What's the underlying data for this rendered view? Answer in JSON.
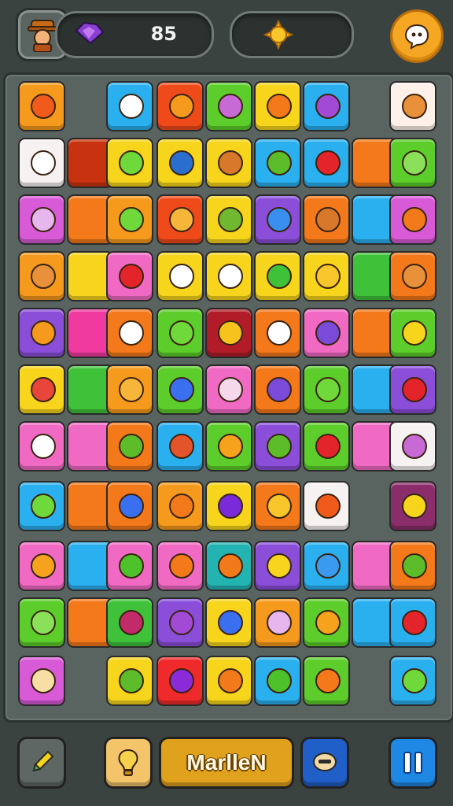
{
  "hud": {
    "score": "85",
    "accent_color": "#f5a623"
  },
  "bottom_bar": {
    "main_button_label": "MarlleN"
  },
  "board": {
    "tiles": [
      {
        "row": 0,
        "col": 0,
        "color": "#f59a1c",
        "icon": "flame-icon"
      },
      {
        "row": 0,
        "col": 2,
        "color": "#2ab0ef",
        "icon": "speech-bubble-icon"
      },
      {
        "row": 0,
        "col": 3,
        "color": "#ef4a1a",
        "icon": "pumpkin-icon"
      },
      {
        "row": 0,
        "col": 4,
        "color": "#5ccd2a",
        "icon": "gear-flower-icon"
      },
      {
        "row": 0,
        "col": 5,
        "color": "#f6d51c",
        "icon": "orange-fruit-icon"
      },
      {
        "row": 0,
        "col": 6,
        "color": "#2ab0ef",
        "icon": "gear-icon"
      },
      {
        "row": 0,
        "col": 8,
        "color": "#fff1ea",
        "icon": "bread-icon"
      },
      {
        "row": 1,
        "col": 0,
        "color": "#f7f2f2",
        "icon": "cream-icon"
      },
      {
        "row": 1,
        "col": 1,
        "color": "#c8320e",
        "icon": ""
      },
      {
        "row": 1,
        "col": 2,
        "color": "#f6d51c",
        "icon": "lime-icon"
      },
      {
        "row": 1,
        "col": 3,
        "color": "#f6d51c",
        "icon": "ring-bubble-icon"
      },
      {
        "row": 1,
        "col": 4,
        "color": "#f6d51c",
        "icon": "acorn-icon"
      },
      {
        "row": 1,
        "col": 5,
        "color": "#2ab0ef",
        "icon": "leaf-icon"
      },
      {
        "row": 1,
        "col": 6,
        "color": "#2ab0ef",
        "icon": "apple-icon"
      },
      {
        "row": 1,
        "col": 7,
        "color": "#f4791a",
        "icon": ""
      },
      {
        "row": 1,
        "col": 8,
        "color": "#5ccd2a",
        "icon": "lettuce-icon"
      },
      {
        "row": 2,
        "col": 0,
        "color": "#d85ad6",
        "icon": "onion-icon"
      },
      {
        "row": 2,
        "col": 1,
        "color": "#f4791a",
        "icon": ""
      },
      {
        "row": 2,
        "col": 2,
        "color": "#f59a1c",
        "icon": "lime-icon"
      },
      {
        "row": 2,
        "col": 3,
        "color": "#ef4a1a",
        "icon": "cookie-icon"
      },
      {
        "row": 2,
        "col": 4,
        "color": "#f6d51c",
        "icon": "turtle-icon"
      },
      {
        "row": 2,
        "col": 5,
        "color": "#8a4ed8",
        "icon": "bubble-icon"
      },
      {
        "row": 2,
        "col": 6,
        "color": "#f4791a",
        "icon": "acorn-icon"
      },
      {
        "row": 2,
        "col": 7,
        "color": "#2ab0ef",
        "icon": ""
      },
      {
        "row": 2,
        "col": 8,
        "color": "#d85ad6",
        "icon": "carrot-icon"
      },
      {
        "row": 3,
        "col": 0,
        "color": "#f59a1c",
        "icon": "bread-icon"
      },
      {
        "row": 3,
        "col": 1,
        "color": "#f6d51c",
        "icon": ""
      },
      {
        "row": 3,
        "col": 2,
        "color": "#f06ac3",
        "icon": "apple-icon"
      },
      {
        "row": 3,
        "col": 3,
        "color": "#f6d51c",
        "icon": "pencil-icon"
      },
      {
        "row": 3,
        "col": 4,
        "color": "#f6d51c",
        "icon": "pencil-icon"
      },
      {
        "row": 3,
        "col": 5,
        "color": "#f6d51c",
        "icon": "pepper-icon"
      },
      {
        "row": 3,
        "col": 6,
        "color": "#f6d51c",
        "icon": "flower-icon"
      },
      {
        "row": 3,
        "col": 7,
        "color": "#3fc13a",
        "icon": ""
      },
      {
        "row": 3,
        "col": 8,
        "color": "#f4791a",
        "icon": "bread-icon"
      },
      {
        "row": 4,
        "col": 0,
        "color": "#8a4ed8",
        "icon": "pumpkin-icon"
      },
      {
        "row": 4,
        "col": 1,
        "color": "#f03aa0",
        "icon": ""
      },
      {
        "row": 4,
        "col": 2,
        "color": "#f4791a",
        "icon": "camera-icon"
      },
      {
        "row": 4,
        "col": 3,
        "color": "#5ccd2a",
        "icon": "cucumber-icon"
      },
      {
        "row": 4,
        "col": 4,
        "color": "#b11c28",
        "icon": "number-seven-icon"
      },
      {
        "row": 4,
        "col": 5,
        "color": "#f4791a",
        "icon": "disc-icon"
      },
      {
        "row": 4,
        "col": 6,
        "color": "#f06ac3",
        "icon": "donut-icon"
      },
      {
        "row": 4,
        "col": 7,
        "color": "#f4791a",
        "icon": ""
      },
      {
        "row": 4,
        "col": 8,
        "color": "#5ccd2a",
        "icon": "critter-icon"
      },
      {
        "row": 5,
        "col": 0,
        "color": "#f6d51c",
        "icon": "cupcake-icon"
      },
      {
        "row": 5,
        "col": 1,
        "color": "#3fc13a",
        "icon": ""
      },
      {
        "row": 5,
        "col": 2,
        "color": "#f59a1c",
        "icon": "cookie-icon"
      },
      {
        "row": 5,
        "col": 3,
        "color": "#5ccd2a",
        "icon": "blueberry-icon"
      },
      {
        "row": 5,
        "col": 4,
        "color": "#f06ac3",
        "icon": "fork-icon"
      },
      {
        "row": 5,
        "col": 5,
        "color": "#f4791a",
        "icon": "donut-icon"
      },
      {
        "row": 5,
        "col": 6,
        "color": "#5ccd2a",
        "icon": "lime-icon"
      },
      {
        "row": 5,
        "col": 7,
        "color": "#2ab0ef",
        "icon": ""
      },
      {
        "row": 5,
        "col": 8,
        "color": "#8a4ed8",
        "icon": "apple-icon"
      },
      {
        "row": 6,
        "col": 0,
        "color": "#f06ac3",
        "icon": "cream-icon"
      },
      {
        "row": 6,
        "col": 1,
        "color": "#f06ac3",
        "icon": ""
      },
      {
        "row": 6,
        "col": 2,
        "color": "#f4791a",
        "icon": "leaf-icon"
      },
      {
        "row": 6,
        "col": 3,
        "color": "#2ab0ef",
        "icon": "chili-icon"
      },
      {
        "row": 6,
        "col": 4,
        "color": "#5ccd2a",
        "icon": "drop-icon"
      },
      {
        "row": 6,
        "col": 5,
        "color": "#8a4ed8",
        "icon": "leaf-icon"
      },
      {
        "row": 6,
        "col": 6,
        "color": "#5ccd2a",
        "icon": "apple-icon"
      },
      {
        "row": 6,
        "col": 7,
        "color": "#f06ac3",
        "icon": ""
      },
      {
        "row": 6,
        "col": 8,
        "color": "#f7f2f2",
        "icon": "bowl-icon"
      },
      {
        "row": 7,
        "col": 0,
        "color": "#2ab0ef",
        "icon": "blob-icon"
      },
      {
        "row": 7,
        "col": 1,
        "color": "#f4791a",
        "icon": ""
      },
      {
        "row": 7,
        "col": 2,
        "color": "#f4791a",
        "icon": "blueberry-icon"
      },
      {
        "row": 7,
        "col": 3,
        "color": "#f59a1c",
        "icon": "carrot-icon"
      },
      {
        "row": 7,
        "col": 4,
        "color": "#f6d51c",
        "icon": "plum-icon"
      },
      {
        "row": 7,
        "col": 5,
        "color": "#f4791a",
        "icon": "flower-icon"
      },
      {
        "row": 7,
        "col": 6,
        "color": "#f7f2f2",
        "icon": "flame-icon"
      },
      {
        "row": 7,
        "col": 8,
        "color": "#8a2d6a",
        "icon": "lemon-icon"
      },
      {
        "row": 8,
        "col": 0,
        "color": "#f06ac3",
        "icon": "star-icon"
      },
      {
        "row": 8,
        "col": 1,
        "color": "#2ab0ef",
        "icon": ""
      },
      {
        "row": 8,
        "col": 2,
        "color": "#f06ac3",
        "icon": "pea-pod-icon"
      },
      {
        "row": 8,
        "col": 3,
        "color": "#f06ac3",
        "icon": "orange-fruit-icon"
      },
      {
        "row": 8,
        "col": 4,
        "color": "#23b3b0",
        "icon": "carrot-icon"
      },
      {
        "row": 8,
        "col": 5,
        "color": "#8a4ed8",
        "icon": "banana-icon"
      },
      {
        "row": 8,
        "col": 6,
        "color": "#2ab0ef",
        "icon": "splash-icon"
      },
      {
        "row": 8,
        "col": 7,
        "color": "#f06ac3",
        "icon": ""
      },
      {
        "row": 8,
        "col": 8,
        "color": "#f4791a",
        "icon": "leaf-icon"
      },
      {
        "row": 9,
        "col": 0,
        "color": "#5ccd2a",
        "icon": "lettuce-icon"
      },
      {
        "row": 9,
        "col": 1,
        "color": "#f4791a",
        "icon": ""
      },
      {
        "row": 9,
        "col": 2,
        "color": "#3fc13a",
        "icon": "raspberry-icon"
      },
      {
        "row": 9,
        "col": 3,
        "color": "#8a4ed8",
        "icon": "gear-icon"
      },
      {
        "row": 9,
        "col": 4,
        "color": "#f6d51c",
        "icon": "blueberry-icon"
      },
      {
        "row": 9,
        "col": 5,
        "color": "#f59a1c",
        "icon": "onion-icon"
      },
      {
        "row": 9,
        "col": 6,
        "color": "#5ccd2a",
        "icon": "ribbon-icon"
      },
      {
        "row": 9,
        "col": 7,
        "color": "#2ab0ef",
        "icon": ""
      },
      {
        "row": 9,
        "col": 8,
        "color": "#2ab0ef",
        "icon": "apple-icon"
      },
      {
        "row": 10,
        "col": 0,
        "color": "#d85ad6",
        "icon": "garlic-icon"
      },
      {
        "row": 10,
        "col": 2,
        "color": "#f6d51c",
        "icon": "leaf-icon"
      },
      {
        "row": 10,
        "col": 3,
        "color": "#ef2a2a",
        "icon": "eggplant-icon"
      },
      {
        "row": 10,
        "col": 4,
        "color": "#f6d51c",
        "icon": "carrot-icon"
      },
      {
        "row": 10,
        "col": 5,
        "color": "#2ab0ef",
        "icon": "ring-icon"
      },
      {
        "row": 10,
        "col": 6,
        "color": "#5ccd2a",
        "icon": "orange-fruit-icon"
      },
      {
        "row": 10,
        "col": 8,
        "color": "#2ab0ef",
        "icon": "lime-icon"
      }
    ]
  }
}
